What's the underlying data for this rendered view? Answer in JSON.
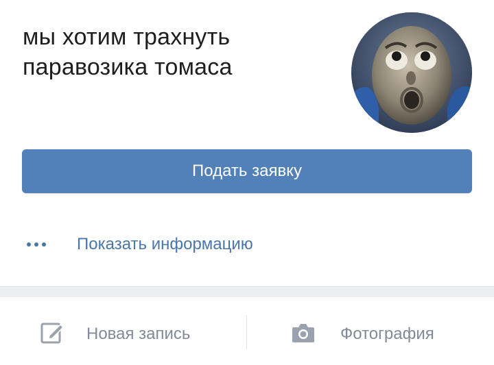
{
  "group": {
    "title": "мы хотим трахнуть паравозика томаса"
  },
  "actions": {
    "join_label": "Подать заявку",
    "show_info_label": "Показать информацию",
    "new_post_label": "Новая запись",
    "photo_label": "Фотография"
  },
  "icons": {
    "more": "more-dots-icon",
    "new_post": "edit-icon",
    "photo": "camera-icon"
  },
  "colors": {
    "accent": "#5181b8",
    "link": "#4a76a8",
    "secondary_text": "#828a99",
    "divider": "#edeef0"
  }
}
